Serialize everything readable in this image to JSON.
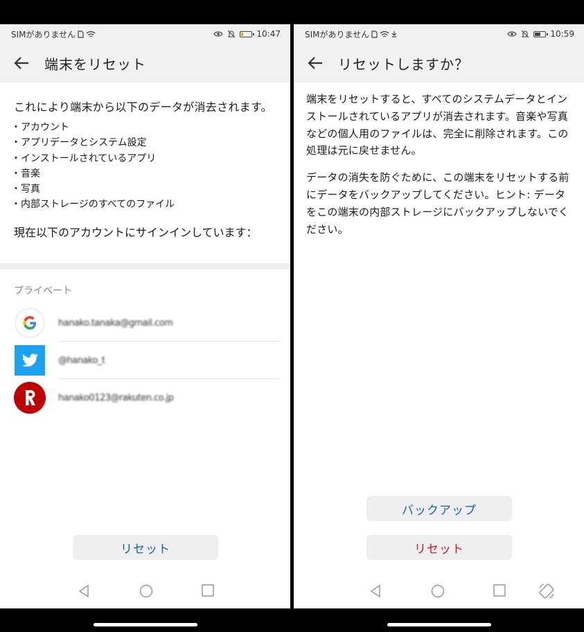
{
  "left": {
    "status": {
      "carrier": "SIMがありません",
      "time": "10:47",
      "battery_level": 0.15
    },
    "title": "端末をリセット",
    "intro": "これにより端末から以下のデータが消去されます。",
    "items": [
      "アカウント",
      "アプリデータとシステム設定",
      "インストールされているアプリ",
      "音楽",
      "写真",
      "内部ストレージのすべてのファイル"
    ],
    "signed_in": "現在以下のアカウントにサインインしています：",
    "section_label": "プライベート",
    "accounts": [
      {
        "icon": "google-icon",
        "text": "hanako.tanaka@gmail.com"
      },
      {
        "icon": "twitter-icon",
        "text": "@hanako_t"
      },
      {
        "icon": "rakuten-icon",
        "text": "hanako0123@rakuten.co.jp"
      }
    ],
    "reset_label": "リセット"
  },
  "right": {
    "status": {
      "carrier": "SIMがありません",
      "time": "10:59",
      "battery_level": 0.5
    },
    "title": "リセットしますか？",
    "paragraph1": "端末をリセットすると、すべてのシステムデータとインストールされているアプリが消去されます。音楽や写真などの個人用のファイルは、完全に削除されます。この処理は元に戻せません。",
    "paragraph2": "データの消失を防ぐために、この端末をリセットする前にデータをバックアップしてください。ヒント: データをこの端末の内部ストレージにバックアップしないでください。",
    "backup_label": "バックアップ",
    "reset_label": "リセット"
  },
  "colors": {
    "accent_blue": "#1a5fb4",
    "danger_red": "#d0181f",
    "google_red": "#ea4335",
    "twitter_blue": "#1da1f2",
    "rakuten_red": "#bf0000"
  }
}
